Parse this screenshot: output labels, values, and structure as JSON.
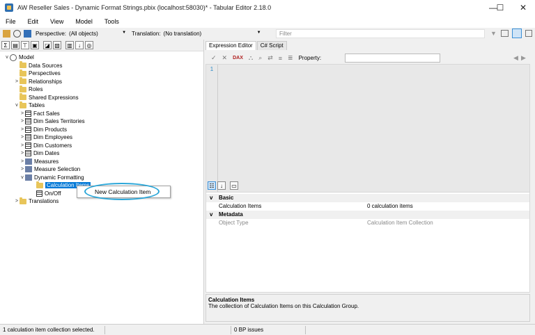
{
  "window": {
    "title": "AW Reseller Sales - Dynamic Format Strings.pbix (localhost:58030)* - Tabular Editor 2.18.0",
    "minimize": "—",
    "maximize": "☐",
    "close": "✕"
  },
  "menu": [
    "File",
    "Edit",
    "View",
    "Model",
    "Tools"
  ],
  "toolbar": {
    "perspective_label": "Perspective:",
    "perspective_value": "(All objects)",
    "translation_label": "Translation:",
    "translation_value": "(No translation)",
    "filter_placeholder": "Filter"
  },
  "tree": {
    "root": "Model",
    "items": [
      {
        "label": "Data Sources",
        "icon": "folder",
        "level": 1,
        "chev": ""
      },
      {
        "label": "Perspectives",
        "icon": "folder",
        "level": 1,
        "chev": ""
      },
      {
        "label": "Relationships",
        "icon": "folder",
        "level": 1,
        "chev": ">"
      },
      {
        "label": "Roles",
        "icon": "folder",
        "level": 1,
        "chev": ""
      },
      {
        "label": "Shared Expressions",
        "icon": "folder",
        "level": 1,
        "chev": ""
      },
      {
        "label": "Tables",
        "icon": "folder",
        "level": 1,
        "chev": "v"
      },
      {
        "label": "Fact Sales",
        "icon": "table",
        "level": 2,
        "chev": ">"
      },
      {
        "label": "Dim Sales Territories",
        "icon": "table",
        "level": 2,
        "chev": ">"
      },
      {
        "label": "Dim Products",
        "icon": "table",
        "level": 2,
        "chev": ">"
      },
      {
        "label": "Dim Employees",
        "icon": "table",
        "level": 2,
        "chev": ">"
      },
      {
        "label": "Dim Customers",
        "icon": "table",
        "level": 2,
        "chev": ">"
      },
      {
        "label": "Dim Dates",
        "icon": "table",
        "level": 2,
        "chev": ">"
      },
      {
        "label": "Measures",
        "icon": "calc",
        "level": 2,
        "chev": ">"
      },
      {
        "label": "Measure Selection",
        "icon": "calc",
        "level": 2,
        "chev": ">"
      },
      {
        "label": "Dynamic Formatting",
        "icon": "calc",
        "level": 2,
        "chev": "v"
      },
      {
        "label": "Calculation Items",
        "icon": "folder",
        "level": 3,
        "chev": "",
        "selected": true
      },
      {
        "label": "On/Off",
        "icon": "table",
        "level": 3,
        "chev": ""
      },
      {
        "label": "Translations",
        "icon": "folder",
        "level": 1,
        "chev": ">"
      }
    ]
  },
  "context_menu": {
    "item": "New Calculation Item"
  },
  "right": {
    "tabs": [
      "Expression Editor",
      "C# Script"
    ],
    "property_label": "Property:",
    "line_number": "1"
  },
  "properties": {
    "basic_label": "Basic",
    "metadata_label": "Metadata",
    "rows": [
      {
        "name": "Calculation Items",
        "value": "0 calculation items"
      },
      {
        "name": "Object Type",
        "value": "Calculation Item Collection"
      }
    ],
    "description_title": "Calculation Items",
    "description_text": "The collection of Calculation Items on this Calculation Group."
  },
  "status": {
    "left": "1 calculation item collection selected.",
    "middle": "0 BP issues"
  }
}
